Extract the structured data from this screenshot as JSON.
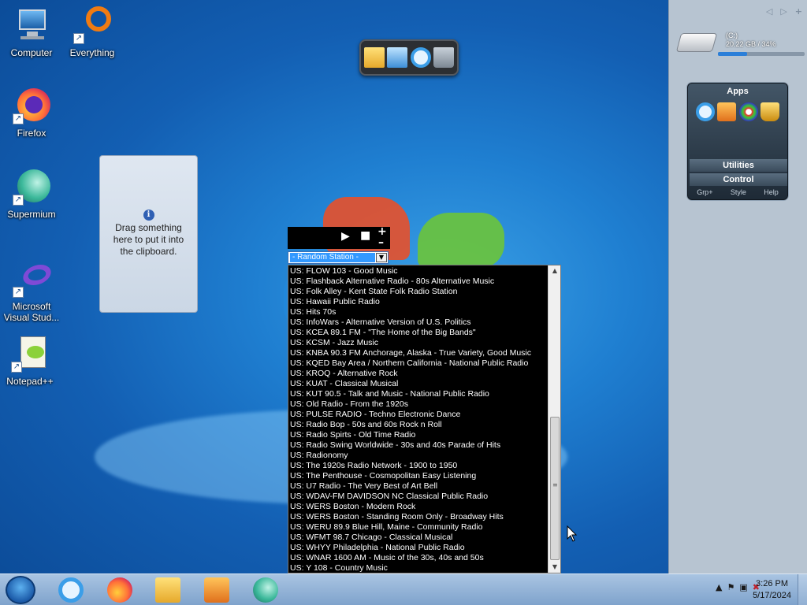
{
  "desktop": {
    "icons": [
      {
        "name": "computer",
        "label": "Computer"
      },
      {
        "name": "everything",
        "label": "Everything"
      },
      {
        "name": "firefox",
        "label": "Firefox"
      },
      {
        "name": "supermium",
        "label": "Supermium"
      },
      {
        "name": "visual-studio",
        "label": "Microsoft Visual Stud..."
      },
      {
        "name": "notepadpp",
        "label": "Notepad++"
      }
    ]
  },
  "clipboard_gadget": {
    "text": "Drag something here to put it into the clipboard."
  },
  "radio_gadget": {
    "selected_station": "- Random Station -",
    "stations": [
      "US: FLOW 103 - Good Music",
      "US: Flashback Alternative Radio - 80s Alternative Music",
      "US: Folk Alley - Kent State Folk Radio Station",
      "US: Hawaii Public Radio",
      "US: Hits 70s",
      "US: InfoWars - Alternative Version of U.S. Politics",
      "US: KCEA 89.1 FM - \"The Home of the Big Bands\"",
      "US: KCSM - Jazz Music",
      "US: KNBA 90.3 FM Anchorage, Alaska - True Variety, Good Music",
      "US: KQED Bay Area / Northern California - National Public Radio",
      "US: KROQ - Alternative Rock",
      "US: KUAT - Classical Musical",
      "US: KUT 90.5 - Talk and Music - National Public Radio",
      "US: Old Radio - From the 1920s",
      "US: PULSE RADIO - Techno Electronic Dance",
      "US: Radio Bop - 50s and 60s Rock n Roll",
      "US: Radio Spirts - Old Time Radio",
      "US: Radio Swing Worldwide - 30s and 40s Parade of Hits",
      "US: Radionomy",
      "US: The 1920s Radio Network - 1900 to 1950",
      "US: The Penthouse - Cosmopolitan Easy Listening",
      "US: U7 Radio - The Very Best of Art Bell",
      "US: WDAV-FM DAVIDSON NC Classical Public Radio",
      "US: WERS Boston - Modern Rock",
      "US: WERS Boston - Standing Room Only - Broadway Hits",
      "US: WERU 89.9 Blue Hill, Maine - Community Radio",
      "US: WFMT 98.7 Chicago - Classical Musical",
      "US: WHYY Philadelphia - National Public Radio",
      "US: WNAR 1600 AM - Music of the 30s, 40s and 50s",
      "US: Y 108 - Country Music"
    ]
  },
  "sidebar": {
    "drive_label": "(C:)",
    "drive_usage": "20.22 GB / 34%",
    "drive_used_fraction": 0.34,
    "apps_title": "Apps",
    "utilities_label": "Utilities",
    "control_label": "Control",
    "footer": {
      "grp": "Grp+",
      "style": "Style",
      "help": "Help"
    }
  },
  "taskbar": {
    "time": "3:26 PM",
    "date": "5/17/2024"
  },
  "colors": {
    "desktop_bg": "#1f7fd1",
    "taskbar": "#8fb0d6",
    "selection": "#3399ff"
  }
}
